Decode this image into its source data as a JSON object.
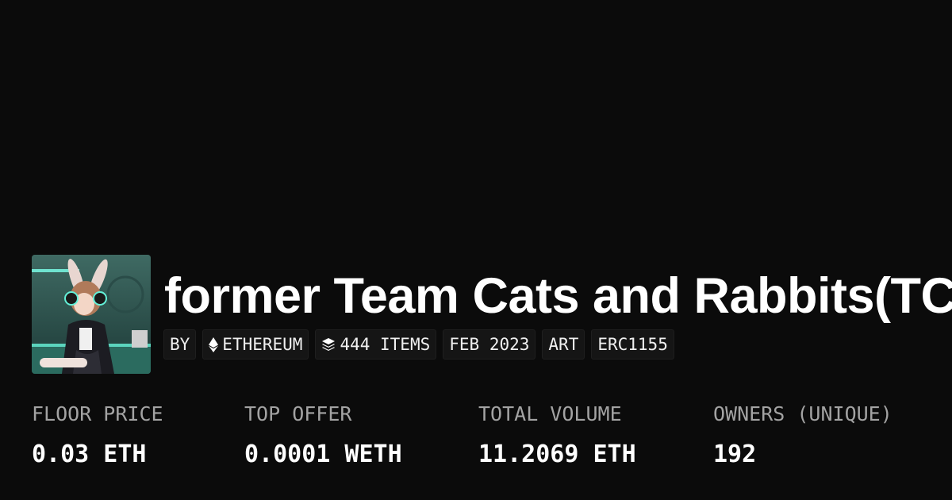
{
  "collection": {
    "title": "former Team Cats and Rabbits(TC",
    "avatar_icon": "anime-rabbit-girl-avatar"
  },
  "chips": [
    {
      "label": "BY",
      "icon": ""
    },
    {
      "label": "ETHEREUM",
      "icon": "ethereum-icon"
    },
    {
      "label": "444 ITEMS",
      "icon": "layers-icon"
    },
    {
      "label": "FEB 2023",
      "icon": ""
    },
    {
      "label": "ART",
      "icon": ""
    },
    {
      "label": "ERC1155",
      "icon": ""
    }
  ],
  "stats": [
    {
      "label": "FLOOR PRICE",
      "value": "0.03 ETH"
    },
    {
      "label": "TOP OFFER",
      "value": "0.0001 WETH"
    },
    {
      "label": "TOTAL VOLUME",
      "value": "11.2069 ETH"
    },
    {
      "label": "OWNERS (UNIQUE)",
      "value": "192"
    }
  ],
  "colors": {
    "background": "#0b0b0b",
    "chip_bg": "#151515",
    "label": "#a3a3a3"
  }
}
